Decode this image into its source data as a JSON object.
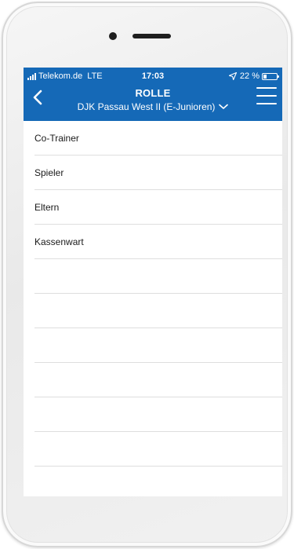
{
  "status_bar": {
    "carrier": "Telekom.de",
    "network": "LTE",
    "time": "17:03",
    "battery_percent": "22 %",
    "battery_level": 0.22,
    "icons": [
      "signal-bars-icon",
      "location-arrow-icon",
      "battery-icon"
    ]
  },
  "header": {
    "title": "ROLLE",
    "subtitle": "DJK Passau West II (E-Junioren)",
    "background_color": "#1569b7",
    "back_icon": "chevron-left-icon",
    "subtitle_icon": "chevron-down-icon",
    "menu_icon": "hamburger-menu-icon"
  },
  "roles": [
    {
      "label": "Co-Trainer"
    },
    {
      "label": "Spieler"
    },
    {
      "label": "Eltern"
    },
    {
      "label": "Kassenwart"
    }
  ],
  "empty_row_count": 7
}
